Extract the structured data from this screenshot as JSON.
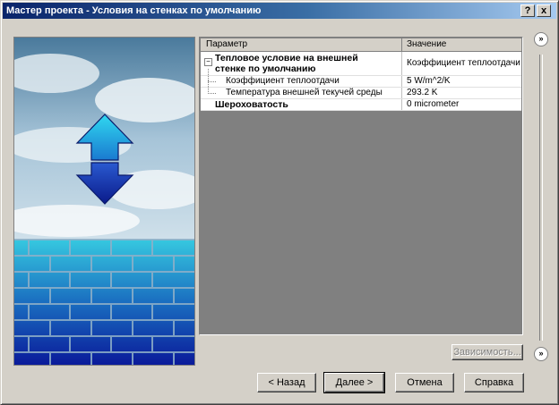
{
  "window": {
    "title": "Мастер проекта - Условия на стенках по умолчанию",
    "help_label": "?",
    "close_label": "x"
  },
  "grid": {
    "col_param": "Параметр",
    "col_value": "Значение",
    "rows": [
      {
        "param": "Тепловое условие на внешней",
        "param2": "стенке по умолчанию",
        "value": "Коэффициент теплоотдачи"
      },
      {
        "param": "Коэффициент теплоотдачи",
        "value": "5 W/m^2/K"
      },
      {
        "param": "Температура внешней текучей среды",
        "value": "293.2 K"
      },
      {
        "param": "Шероховатость",
        "value": "0 micrometer"
      }
    ]
  },
  "buttons": {
    "dependencies": "Зависимость...",
    "back": "< Назад",
    "next": "Далее >",
    "cancel": "Отмена",
    "help": "Справка"
  },
  "side_icons": {
    "top": "»",
    "bottom": "»"
  }
}
